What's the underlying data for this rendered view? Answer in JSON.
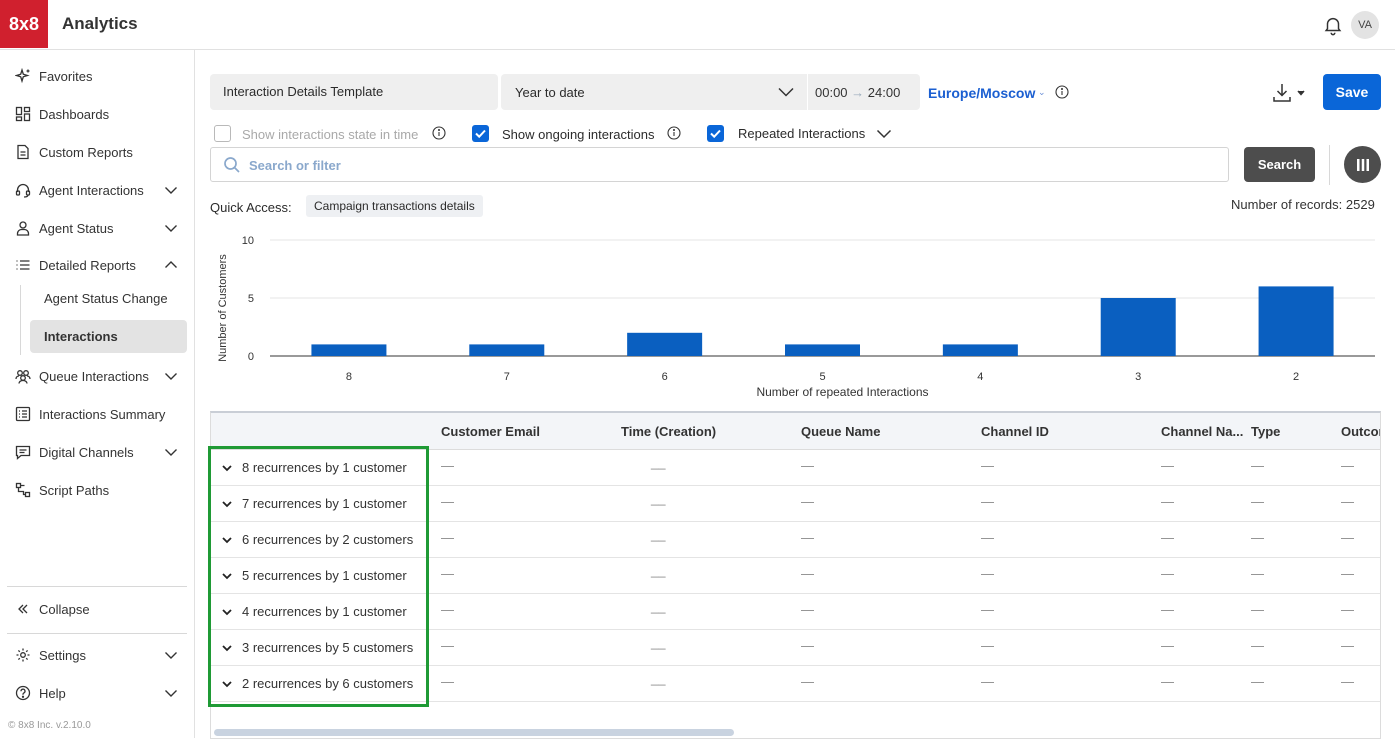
{
  "header": {
    "logo_text": "8x8",
    "app_title": "Analytics",
    "avatar_initials": "VA"
  },
  "sidebar": {
    "items": [
      {
        "label": "Favorites",
        "icon": "sparkle-icon"
      },
      {
        "label": "Dashboards",
        "icon": "dashboard-icon"
      },
      {
        "label": "Custom Reports",
        "icon": "document-icon"
      },
      {
        "label": "Agent Interactions",
        "icon": "headset-icon",
        "expandable": true
      },
      {
        "label": "Agent Status",
        "icon": "person-icon",
        "expandable": true
      },
      {
        "label": "Detailed Reports",
        "icon": "list-icon",
        "expandable": true,
        "expanded": true
      },
      {
        "label": "Queue Interactions",
        "icon": "group-icon",
        "expandable": true
      },
      {
        "label": "Interactions Summary",
        "icon": "summary-icon"
      },
      {
        "label": "Digital Channels",
        "icon": "chat-icon",
        "expandable": true
      },
      {
        "label": "Script Paths",
        "icon": "flow-icon"
      }
    ],
    "sub_items": [
      {
        "label": "Agent Status Change"
      },
      {
        "label": "Interactions",
        "active": true
      }
    ],
    "collapse_label": "Collapse",
    "settings_label": "Settings",
    "help_label": "Help",
    "version": "© 8x8 Inc. v.2.10.0"
  },
  "toolbar": {
    "template": "Interaction Details Template",
    "date_range": "Year to date",
    "time_from": "00:00",
    "time_arrow": "→",
    "time_to": "24:00",
    "timezone": "Europe/Moscow",
    "save_label": "Save"
  },
  "filters": {
    "show_state_label": "Show interactions state in time",
    "show_state_checked": false,
    "show_ongoing_label": "Show ongoing interactions",
    "show_ongoing_checked": true,
    "repeated_label": "Repeated Interactions",
    "repeated_checked": true
  },
  "search": {
    "placeholder": "Search or filter",
    "button_label": "Search"
  },
  "quick_access": {
    "label": "Quick Access:",
    "chip": "Campaign transactions details"
  },
  "records_label": "Number of records: 2529",
  "chart_data": {
    "type": "bar",
    "categories": [
      "8",
      "7",
      "6",
      "5",
      "4",
      "3",
      "2"
    ],
    "values": [
      1,
      1,
      2,
      1,
      1,
      5,
      6
    ],
    "xlabel": "Number of repeated Interactions",
    "ylabel": "Number of Customers",
    "ylim": [
      0,
      10
    ],
    "yticks": [
      0,
      5,
      10
    ],
    "color": "#0a5fc0",
    "grid": true
  },
  "table": {
    "columns": [
      "Customer Email",
      "Time (Creation)",
      "Queue Name",
      "Channel ID",
      "Channel Na...",
      "Type",
      "Outcom"
    ],
    "rows": [
      {
        "label": "8 recurrences by 1 customer"
      },
      {
        "label": "7 recurrences by 1 customer"
      },
      {
        "label": "6 recurrences by 2 customers"
      },
      {
        "label": "5 recurrences by 1 customer"
      },
      {
        "label": "4 recurrences by 1 customer"
      },
      {
        "label": "3 recurrences by 5 customers"
      },
      {
        "label": "2 recurrences by 6 customers"
      }
    ],
    "empty_cell": "—",
    "empty_time_cell": "__"
  },
  "colors": {
    "brand_red": "#d0202e",
    "accent_blue": "#0a66d8",
    "highlight_green": "#1f9a35"
  }
}
